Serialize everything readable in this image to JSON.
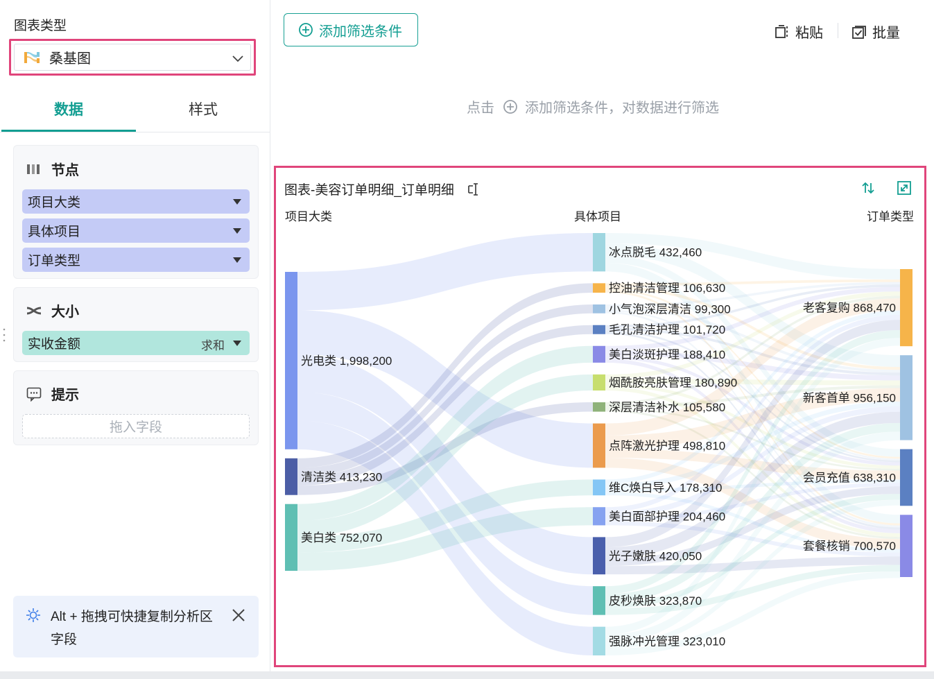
{
  "left_panel": {
    "chart_type_label": "图表类型",
    "chart_type_value": "桑基图",
    "tabs": {
      "data": "数据",
      "style": "样式"
    },
    "node_card": {
      "title": "节点",
      "fields": [
        "项目大类",
        "具体项目",
        "订单类型"
      ]
    },
    "size_card": {
      "title": "大小",
      "field": "实收金额",
      "aggregation": "求和"
    },
    "tooltip_card": {
      "title": "提示",
      "placeholder": "拖入字段"
    },
    "tip_banner": "Alt + 拖拽可快捷复制分析区字段"
  },
  "toolbar": {
    "add_filter": "添加筛选条件",
    "paste": "粘贴",
    "batch": "批量",
    "hint_prefix": "点击",
    "hint_suffix": "添加筛选条件，对数据进行筛选"
  },
  "colors": {
    "accent": "#139e92",
    "highlight_border": "#e0457b"
  },
  "chart_data": {
    "type": "sankey",
    "title": "图表-美容订单明细_订单明细",
    "level_labels": [
      "项目大类",
      "具体项目",
      "订单类型"
    ],
    "nodes": [
      {
        "id": "光电类",
        "level": 0,
        "value": 1998200,
        "label": "光电类 1,998,200",
        "color": "#7b96ee"
      },
      {
        "id": "清洁类",
        "level": 0,
        "value": 413230,
        "label": "清洁类 413,230",
        "color": "#4c5ea6"
      },
      {
        "id": "美白类",
        "level": 0,
        "value": 752070,
        "label": "美白类 752,070",
        "color": "#5fbfb3"
      },
      {
        "id": "冰点脱毛",
        "level": 1,
        "value": 432460,
        "label": "冰点脱毛 432,460",
        "color": "#9fd6e0"
      },
      {
        "id": "控油清洁管理",
        "level": 1,
        "value": 106630,
        "label": "控油清洁管理 106,630",
        "color": "#f6b44a"
      },
      {
        "id": "小气泡深层清洁",
        "level": 1,
        "value": 99300,
        "label": "小气泡深层清洁 99,300",
        "color": "#9fc2e2"
      },
      {
        "id": "毛孔清洁护理",
        "level": 1,
        "value": 101720,
        "label": "毛孔清洁护理 101,720",
        "color": "#5b80c2"
      },
      {
        "id": "美白淡斑护理",
        "level": 1,
        "value": 188410,
        "label": "美白淡斑护理 188,410",
        "color": "#8a8ae6"
      },
      {
        "id": "烟酰胺亮肤管理",
        "level": 1,
        "value": 180890,
        "label": "烟酰胺亮肤管理 180,890",
        "color": "#c7de6e"
      },
      {
        "id": "深层清洁补水",
        "level": 1,
        "value": 105580,
        "label": "深层清洁补水 105,580",
        "color": "#8fb27a"
      },
      {
        "id": "点阵激光护理",
        "level": 1,
        "value": 498810,
        "label": "点阵激光护理 498,810",
        "color": "#eb9b4d"
      },
      {
        "id": "维C焕白导入",
        "level": 1,
        "value": 178310,
        "label": "维C焕白导入 178,310",
        "color": "#84c6f5"
      },
      {
        "id": "美白面部护理",
        "level": 1,
        "value": 204460,
        "label": "美白面部护理 204,460",
        "color": "#86a2f0"
      },
      {
        "id": "光子嫩肤",
        "level": 1,
        "value": 420050,
        "label": "光子嫩肤 420,050",
        "color": "#4a5fac"
      },
      {
        "id": "皮秒焕肤",
        "level": 1,
        "value": 323870,
        "label": "皮秒焕肤 323,870",
        "color": "#5fbfb3"
      },
      {
        "id": "强脉冲光管理",
        "level": 1,
        "value": 323010,
        "label": "强脉冲光管理 323,010",
        "color": "#a3dbe4"
      },
      {
        "id": "老客复购",
        "level": 2,
        "value": 868470,
        "label": "老客复购 868,470",
        "color": "#f6b44a"
      },
      {
        "id": "新客首单",
        "level": 2,
        "value": 956150,
        "label": "新客首单 956,150",
        "color": "#9fc2e2"
      },
      {
        "id": "会员充值",
        "level": 2,
        "value": 638310,
        "label": "会员充值 638,310",
        "color": "#5b80c2"
      },
      {
        "id": "套餐核销",
        "level": 2,
        "value": 700570,
        "label": "套餐核销 700,570",
        "color": "#8a8ae6"
      }
    ],
    "links": [
      {
        "source": "光电类",
        "target": "冰点脱毛",
        "value": 432460
      },
      {
        "source": "光电类",
        "target": "点阵激光护理",
        "value": 498810
      },
      {
        "source": "光电类",
        "target": "光子嫩肤",
        "value": 420050
      },
      {
        "source": "光电类",
        "target": "皮秒焕肤",
        "value": 323870
      },
      {
        "source": "光电类",
        "target": "强脉冲光管理",
        "value": 323010
      },
      {
        "source": "清洁类",
        "target": "控油清洁管理",
        "value": 106630
      },
      {
        "source": "清洁类",
        "target": "小气泡深层清洁",
        "value": 99300
      },
      {
        "source": "清洁类",
        "target": "毛孔清洁护理",
        "value": 101720
      },
      {
        "source": "清洁类",
        "target": "深层清洁补水",
        "value": 105580
      },
      {
        "source": "美白类",
        "target": "美白淡斑护理",
        "value": 188410
      },
      {
        "source": "美白类",
        "target": "烟酰胺亮肤管理",
        "value": 180890
      },
      {
        "source": "美白类",
        "target": "维C焕白导入",
        "value": 178310
      },
      {
        "source": "美白类",
        "target": "美白面部护理",
        "value": 204460
      },
      {
        "source": "冰点脱毛",
        "target": "老客复购",
        "value": 117000
      },
      {
        "source": "冰点脱毛",
        "target": "新客首单",
        "value": 132000
      },
      {
        "source": "冰点脱毛",
        "target": "会员充值",
        "value": 87000
      },
      {
        "source": "冰点脱毛",
        "target": "套餐核销",
        "value": 96460
      },
      {
        "source": "控油清洁管理",
        "target": "老客复购",
        "value": 29000
      },
      {
        "source": "控油清洁管理",
        "target": "新客首单",
        "value": 33000
      },
      {
        "source": "控油清洁管理",
        "target": "会员充值",
        "value": 21000
      },
      {
        "source": "控油清洁管理",
        "target": "套餐核销",
        "value": 23630
      },
      {
        "source": "小气泡深层清洁",
        "target": "老客复购",
        "value": 27000
      },
      {
        "source": "小气泡深层清洁",
        "target": "新客首单",
        "value": 31000
      },
      {
        "source": "小气泡深层清洁",
        "target": "会员充值",
        "value": 19000
      },
      {
        "source": "小气泡深层清洁",
        "target": "套餐核销",
        "value": 22300
      },
      {
        "source": "毛孔清洁护理",
        "target": "老客复购",
        "value": 28000
      },
      {
        "source": "毛孔清洁护理",
        "target": "新客首单",
        "value": 31000
      },
      {
        "source": "毛孔清洁护理",
        "target": "会员充值",
        "value": 20000
      },
      {
        "source": "毛孔清洁护理",
        "target": "套餐核销",
        "value": 22720
      },
      {
        "source": "美白淡斑护理",
        "target": "老客复购",
        "value": 51000
      },
      {
        "source": "美白淡斑护理",
        "target": "新客首单",
        "value": 57000
      },
      {
        "source": "美白淡斑护理",
        "target": "会员充值",
        "value": 38000
      },
      {
        "source": "美白淡斑护理",
        "target": "套餐核销",
        "value": 42410
      },
      {
        "source": "烟酰胺亮肤管理",
        "target": "老客复购",
        "value": 49000
      },
      {
        "source": "烟酰胺亮肤管理",
        "target": "新客首单",
        "value": 55000
      },
      {
        "source": "烟酰胺亮肤管理",
        "target": "会员充值",
        "value": 36000
      },
      {
        "source": "烟酰胺亮肤管理",
        "target": "套餐核销",
        "value": 40890
      },
      {
        "source": "深层清洁补水",
        "target": "老客复购",
        "value": 29000
      },
      {
        "source": "深层清洁补水",
        "target": "新客首单",
        "value": 32000
      },
      {
        "source": "深层清洁补水",
        "target": "会员充值",
        "value": 21000
      },
      {
        "source": "深层清洁补水",
        "target": "套餐核销",
        "value": 23580
      },
      {
        "source": "点阵激光护理",
        "target": "老客复购",
        "value": 136000
      },
      {
        "source": "点阵激光护理",
        "target": "新客首单",
        "value": 150000
      },
      {
        "source": "点阵激光护理",
        "target": "会员充值",
        "value": 100000
      },
      {
        "source": "点阵激光护理",
        "target": "套餐核销",
        "value": 112810
      },
      {
        "source": "维C焕白导入",
        "target": "老客复购",
        "value": 49000
      },
      {
        "source": "维C焕白导入",
        "target": "新客首单",
        "value": 54000
      },
      {
        "source": "维C焕白导入",
        "target": "会员充值",
        "value": 36000
      },
      {
        "source": "维C焕白导入",
        "target": "套餐核销",
        "value": 39310
      },
      {
        "source": "美白面部护理",
        "target": "老客复购",
        "value": 56000
      },
      {
        "source": "美白面部护理",
        "target": "新客首单",
        "value": 62000
      },
      {
        "source": "美白面部护理",
        "target": "会员充值",
        "value": 41000
      },
      {
        "source": "美白面部护理",
        "target": "套餐核销",
        "value": 45460
      },
      {
        "source": "光子嫩肤",
        "target": "老客复购",
        "value": 115000
      },
      {
        "source": "光子嫩肤",
        "target": "新客首单",
        "value": 126000
      },
      {
        "source": "光子嫩肤",
        "target": "会员充值",
        "value": 85000
      },
      {
        "source": "光子嫩肤",
        "target": "套餐核销",
        "value": 94050
      },
      {
        "source": "皮秒焕肤",
        "target": "老客复购",
        "value": 88000
      },
      {
        "source": "皮秒焕肤",
        "target": "新客首单",
        "value": 97000
      },
      {
        "source": "皮秒焕肤",
        "target": "会员充值",
        "value": 65000
      },
      {
        "source": "皮秒焕肤",
        "target": "套餐核销",
        "value": 73870
      },
      {
        "source": "强脉冲光管理",
        "target": "老客复购",
        "value": 88000
      },
      {
        "source": "强脉冲光管理",
        "target": "新客首单",
        "value": 97000
      },
      {
        "source": "强脉冲光管理",
        "target": "会员充值",
        "value": 64000
      },
      {
        "source": "强脉冲光管理",
        "target": "套餐核销",
        "value": 74010
      }
    ]
  }
}
